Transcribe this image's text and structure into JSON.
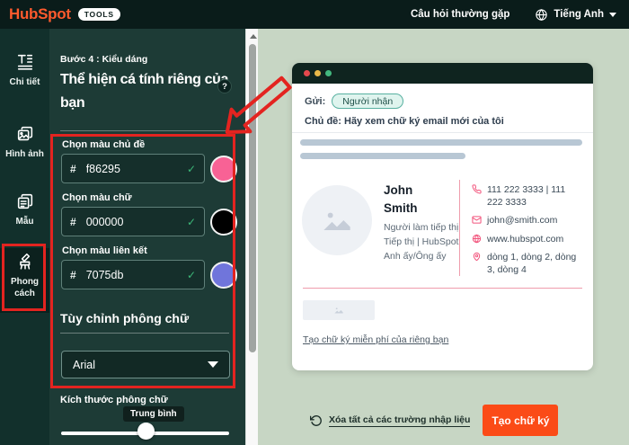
{
  "topbar": {
    "logo": "HubSpot",
    "badge": "TOOLS",
    "faq": "Câu hỏi thường gặp",
    "language": "Tiếng Anh"
  },
  "sidebar": {
    "items": [
      {
        "label": "Chi tiết",
        "icon": "text-details-icon"
      },
      {
        "label": "Hình ảnh",
        "icon": "image-icon"
      },
      {
        "label": "Mẫu",
        "icon": "template-icon"
      },
      {
        "label": "Phong cách",
        "icon": "paintbrush-icon",
        "active": true
      }
    ]
  },
  "panel": {
    "step": "Bước 4 : Kiểu dáng",
    "title": "Thể hiện cá tính riêng của bạn",
    "help_badge": "?",
    "fields": [
      {
        "label": "Chọn màu chủ đề",
        "prefix": "#",
        "value": "f86295",
        "swatch": "#f86295"
      },
      {
        "label": "Chọn màu chữ",
        "prefix": "#",
        "value": "000000",
        "swatch": "#000000"
      },
      {
        "label": "Chọn màu liên kết",
        "prefix": "#",
        "value": "7075db",
        "swatch": "#7075db"
      }
    ],
    "check_mark": "✓",
    "font_section_title": "Tùy chỉnh phông chữ",
    "font_selected": "Arial",
    "size_label": "Kích thước phông chữ",
    "size_value": "Trung bình"
  },
  "preview": {
    "to_label": "Gửi:",
    "recipient_pill": "Người nhận",
    "subject": "Chủ đề: Hãy xem chữ ký email mới của tôi",
    "name": "John Smith",
    "job_title": "Người làm tiếp thị",
    "department": "Tiếp thị | HubSpot",
    "pronouns": "Anh ấy/Ông ấy",
    "phone": "111 222 3333 | 111 222 3333",
    "email": "john@smith.com",
    "website": "www.hubspot.com",
    "address": "dòng 1, dòng 2, dòng 3, dòng 4",
    "cta_link": "Tạo chữ ký miễn phí của riêng bạn"
  },
  "footer": {
    "clear_label": "Xóa tất cả các trường nhập liệu",
    "create_label": "Tạo chữ ký"
  },
  "colors": {
    "brand_orange": "#ff5a2d",
    "button_orange": "#fb4b17",
    "annotation_red": "#e32420",
    "theme_pink": "#f2547c",
    "link_purple": "#7075db",
    "dot_red": "#e5484d",
    "dot_yellow": "#e9b949",
    "dot_green": "#43b97f"
  }
}
